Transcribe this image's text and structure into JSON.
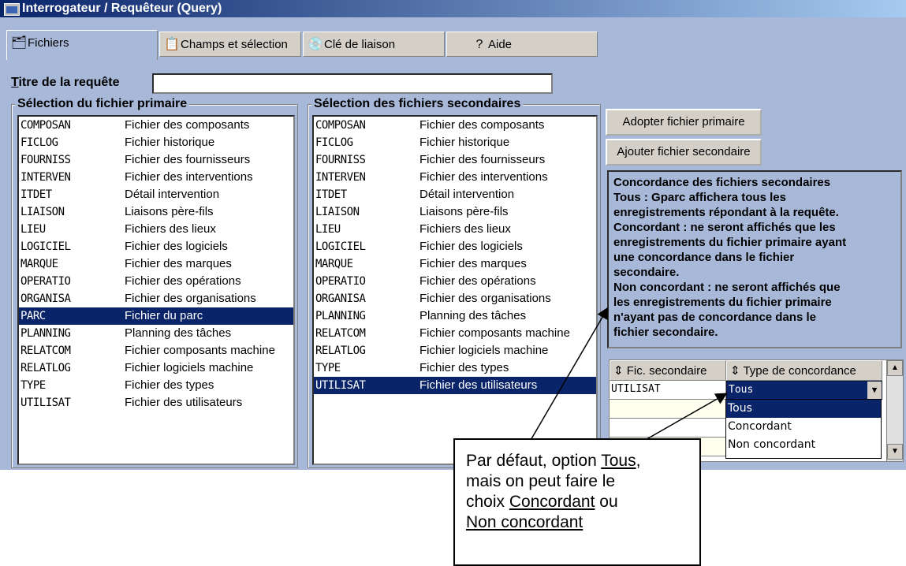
{
  "window": {
    "title": "Interrogateur / Requêteur (Query)"
  },
  "tabs": [
    {
      "label": "Fichiers",
      "icon": "files-icon"
    },
    {
      "label": "Champs et sélection",
      "icon": "fields-icon"
    },
    {
      "label": "Clé de liaison",
      "icon": "key-disc-icon"
    },
    {
      "label": "Aide",
      "icon": "help-icon"
    }
  ],
  "query_title": {
    "label": "Titre de la requête",
    "value": ""
  },
  "primary": {
    "legend": "Sélection du fichier primaire",
    "items": [
      {
        "code": "COMPOSAN",
        "desc": "Fichier des composants"
      },
      {
        "code": "FICLOG",
        "desc": "Fichier historique"
      },
      {
        "code": "FOURNISS",
        "desc": "Fichier des fournisseurs"
      },
      {
        "code": "INTERVEN",
        "desc": "Fichier des interventions"
      },
      {
        "code": "ITDET",
        "desc": "Détail intervention"
      },
      {
        "code": "LIAISON",
        "desc": "Liaisons père-fils"
      },
      {
        "code": "LIEU",
        "desc": "Fichiers des lieux"
      },
      {
        "code": "LOGICIEL",
        "desc": "Fichier des logiciels"
      },
      {
        "code": "MARQUE",
        "desc": "Fichier des marques"
      },
      {
        "code": "OPERATIO",
        "desc": "Fichier des opérations"
      },
      {
        "code": "ORGANISA",
        "desc": "Fichier des organisations"
      },
      {
        "code": "PARC",
        "desc": "Fichier du parc"
      },
      {
        "code": "PLANNING",
        "desc": "Planning des tâches"
      },
      {
        "code": "RELATCOM",
        "desc": "Fichier composants machine"
      },
      {
        "code": "RELATLOG",
        "desc": "Fichier logiciels machine"
      },
      {
        "code": "TYPE",
        "desc": "Fichier des types"
      },
      {
        "code": "UTILISAT",
        "desc": "Fichier des utilisateurs"
      }
    ],
    "selected": "PARC"
  },
  "secondary": {
    "legend": "Sélection des fichiers secondaires",
    "items": [
      {
        "code": "COMPOSAN",
        "desc": "Fichier des composants"
      },
      {
        "code": "FICLOG",
        "desc": "Fichier historique"
      },
      {
        "code": "FOURNISS",
        "desc": "Fichier des fournisseurs"
      },
      {
        "code": "INTERVEN",
        "desc": "Fichier des interventions"
      },
      {
        "code": "ITDET",
        "desc": "Détail intervention"
      },
      {
        "code": "LIAISON",
        "desc": "Liaisons père-fils"
      },
      {
        "code": "LIEU",
        "desc": "Fichiers des lieux"
      },
      {
        "code": "LOGICIEL",
        "desc": "Fichier des logiciels"
      },
      {
        "code": "MARQUE",
        "desc": "Fichier des marques"
      },
      {
        "code": "OPERATIO",
        "desc": "Fichier des opérations"
      },
      {
        "code": "ORGANISA",
        "desc": "Fichier des organisations"
      },
      {
        "code": "PLANNING",
        "desc": "Planning des tâches"
      },
      {
        "code": "RELATCOM",
        "desc": "Fichier composants machine"
      },
      {
        "code": "RELATLOG",
        "desc": "Fichier logiciels machine"
      },
      {
        "code": "TYPE",
        "desc": "Fichier des types"
      },
      {
        "code": "UTILISAT",
        "desc": "Fichier des utilisateurs"
      }
    ],
    "selected": "UTILISAT"
  },
  "buttons": {
    "adopt": "Adopter fichier primaire",
    "add": "Ajouter fichier secondaire"
  },
  "note": {
    "lines": [
      "Concordance des fichiers secondaires",
      "Tous : Gparc affichera tous les",
      "enregistrements répondant à la requête.",
      "Concordant : ne seront affichés que les",
      "enregistrements du fichier primaire ayant",
      "une concordance dans le fichier",
      "secondaire.",
      "Non concordant : ne seront affichés que",
      "les enregistrements du fichier primaire",
      "n'ayant pas de concordance dans le",
      "fichier secondaire."
    ]
  },
  "grid": {
    "col1": "Fic. secondaire",
    "col2": "Type de concordance",
    "row1": {
      "file": "UTILISAT",
      "type": "Tous"
    }
  },
  "dropdown": {
    "options": [
      "Tous",
      "Concordant",
      "Non concordant"
    ],
    "selected": "Tous"
  },
  "callout": {
    "p1": "Par défaut, option ",
    "u1": "Tous",
    "p2": ",",
    "p3": "mais on peut faire le",
    "p4": "choix ",
    "u2": "Concordant",
    "p5": " ou",
    "u3": "Non concordant"
  }
}
